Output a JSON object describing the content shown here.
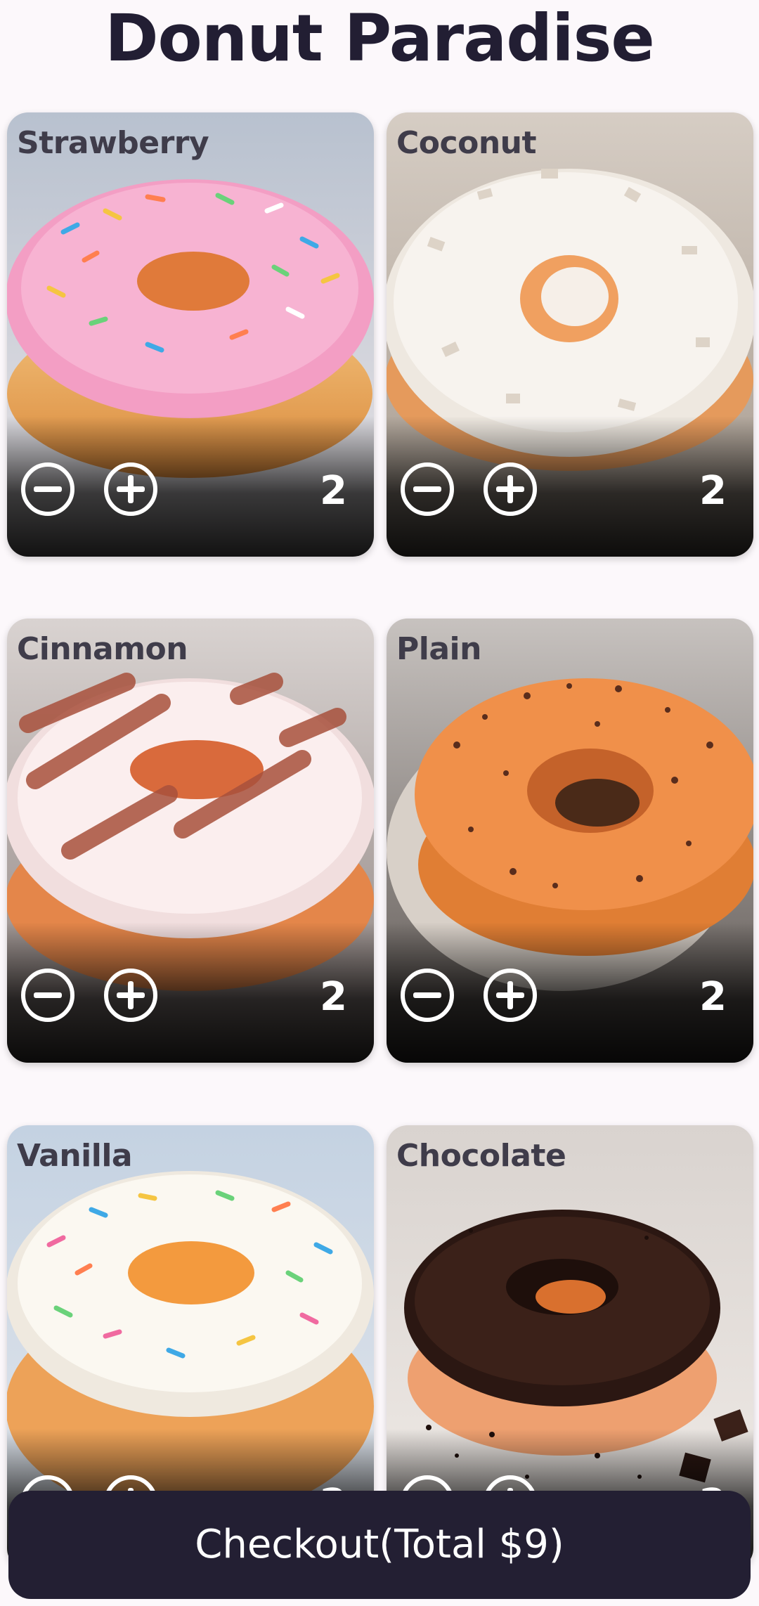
{
  "app": {
    "title": "Donut Paradise"
  },
  "donuts": [
    {
      "name": "Strawberry",
      "quantity": "2"
    },
    {
      "name": "Coconut",
      "quantity": "2"
    },
    {
      "name": "Cinnamon",
      "quantity": "2"
    },
    {
      "name": "Plain",
      "quantity": "2"
    },
    {
      "name": "Vanilla",
      "quantity": "2"
    },
    {
      "name": "Chocolate",
      "quantity": "2"
    }
  ],
  "checkout": {
    "label": "Checkout(Total $9)"
  },
  "icons": {
    "decrement": "minus-circle-icon",
    "increment": "plus-circle-icon"
  },
  "colors": {
    "title": "#221e33",
    "checkout_bg": "#231f33",
    "page_bg": "#fcf8fb"
  }
}
